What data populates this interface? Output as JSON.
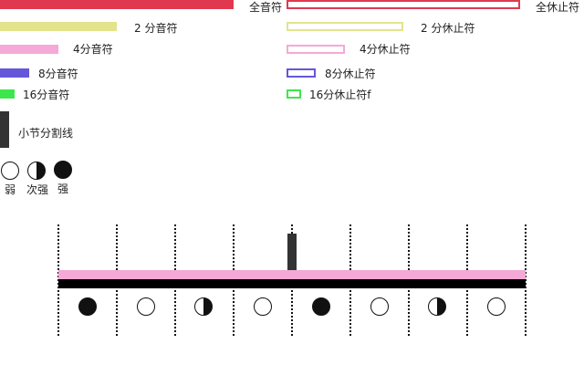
{
  "legend": {
    "whole_note": "全音符",
    "whole_rest": "全休止符",
    "half_note": "2 分音符",
    "half_rest": "2 分休止符",
    "quarter_note": "4分音符",
    "quarter_rest": "4分休止符",
    "eighth_note": "8分音符",
    "eighth_rest": "8分休止符",
    "sixteenth_note": "16分音符",
    "sixteenth_rest": "16分休止符f",
    "barline": "小节分割线",
    "beat_weak": "弱",
    "beat_sub": "次强",
    "beat_strong": "强"
  },
  "colors": {
    "whole": "#e0394f",
    "half": "#e3e38b",
    "quarter": "#f4a9d6",
    "eighth": "#6457d9",
    "sixteenth": "#3ee64d",
    "barline": "#333333"
  },
  "icons": {
    "weak": "open-circle-icon",
    "sub_strong": "half-filled-circle-icon",
    "strong": "filled-circle-icon"
  },
  "timeline": {
    "track_note": "quarter",
    "beats": [
      "strong",
      "weak",
      "sub_strong",
      "weak",
      "strong",
      "weak",
      "sub_strong",
      "weak"
    ]
  }
}
